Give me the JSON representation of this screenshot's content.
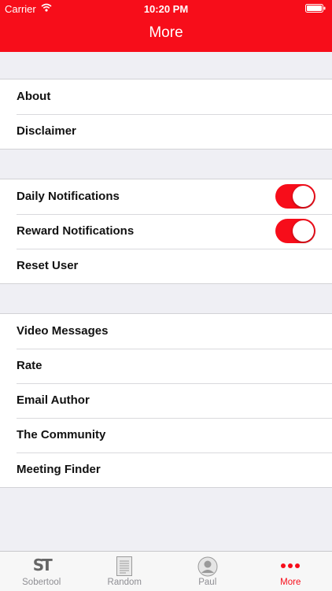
{
  "status_bar": {
    "carrier": "Carrier",
    "time": "10:20 PM"
  },
  "nav": {
    "title": "More"
  },
  "groups": [
    {
      "items": [
        {
          "label": "About"
        },
        {
          "label": "Disclaimer"
        }
      ]
    },
    {
      "items": [
        {
          "label": "Daily Notifications",
          "toggle": true
        },
        {
          "label": "Reward Notifications",
          "toggle": true
        },
        {
          "label": "Reset User"
        }
      ]
    },
    {
      "items": [
        {
          "label": "Video Messages"
        },
        {
          "label": "Rate"
        },
        {
          "label": "Email Author"
        },
        {
          "label": "The Community"
        },
        {
          "label": "Meeting Finder"
        }
      ]
    }
  ],
  "tabs": [
    {
      "label": "Sobertool",
      "logo": "ST",
      "icon": "sobertool-logo-icon"
    },
    {
      "label": "Random",
      "icon": "document-icon"
    },
    {
      "label": "Paul",
      "icon": "person-icon"
    },
    {
      "label": "More",
      "icon": "more-dots-icon",
      "active": true
    }
  ],
  "colors": {
    "accent": "#f70d1a",
    "background": "#efeff4",
    "tab_inactive": "#8e8e93"
  }
}
